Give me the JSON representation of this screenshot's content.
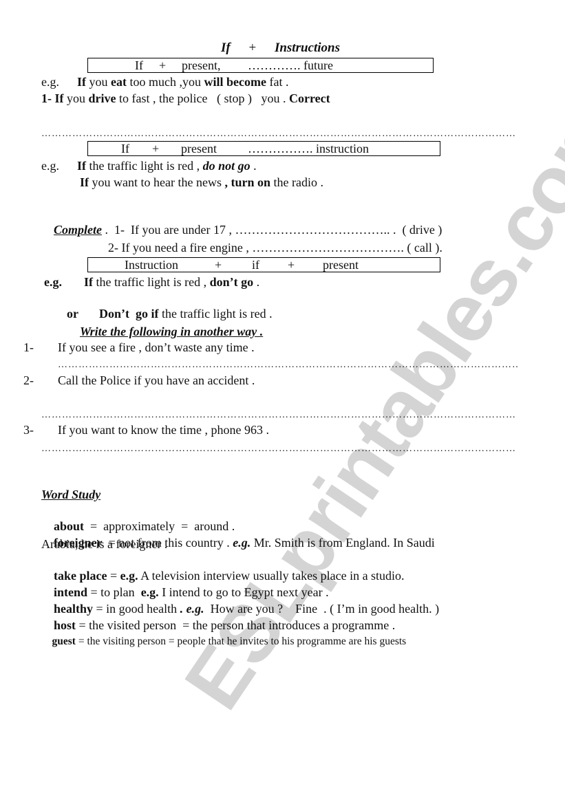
{
  "watermark": "ESLprintables.com",
  "title": {
    "if": "If",
    "plus": "+",
    "instructions": "Instructions"
  },
  "box1": {
    "if": "If",
    "plus": "+",
    "present": "present,",
    "dots": "…………. future"
  },
  "example1": {
    "eg": "e.g.",
    "if": "If",
    "you": " you ",
    "eat": "eat",
    "mid": " too much ,you ",
    "will_become": "will become",
    "end": " fat ."
  },
  "exercise1": {
    "num_if": "1- If",
    "you": " you ",
    "drive": "drive",
    "mid": " to fast , the police   ( stop )   you . ",
    "correct": "Correct"
  },
  "answer_line": "…………………………………………………………………………………………………………………………",
  "box2": {
    "if": "If",
    "plus": "+",
    "present": "present",
    "dots": "……………. instruction"
  },
  "example2": {
    "eg": "e.g.",
    "if": "If",
    "line1_rest": " the traffic light is red , ",
    "do_not_go": "do not go",
    "end1": " .",
    "if2": "If",
    "line2_mid": " you want to hear the news ",
    "turn_on": ", turn on",
    "line2_end": " the radio ."
  },
  "complete": {
    "label": "Complete",
    "item1": " .  1-  If you are under 17 , ……………………………….. .  ( drive )",
    "item2": "2- If you need a fire engine , ………………………………. (  call )."
  },
  "box3": {
    "instruction": "Instruction",
    "plus1": "+",
    "if": "if",
    "plus2": "+",
    "present": "present"
  },
  "example3": {
    "eg": "e.g.",
    "if": "If",
    "rest1": " the traffic light is red , ",
    "dont_go": "don’t go",
    "end1": " .",
    "or": "or",
    "dont_go_if": "Don’t  go if",
    "rest2": " the traffic light is red ."
  },
  "rewrite": {
    "heading": "Write the following in another way .",
    "items": [
      {
        "num": "1-",
        "text": "If you see a fire , don’t waste any time ."
      },
      {
        "num": "2-",
        "text": "Call the Police if you have an accident ."
      },
      {
        "num": "3-",
        "text": "If you want to know the time , phone 963 ."
      }
    ]
  },
  "word_study": {
    "heading": "Word Study",
    "entries": [
      {
        "word": "about",
        "def": "  =  approximately  =  around ."
      },
      {
        "word": "foreigner",
        "def": "  = not from this country . ",
        "eg": "e.g.",
        "ex": " Mr. Smith is from England. In Saudi",
        "ex2": "Arabia, he is a foreigner ."
      },
      {
        "word": "take place",
        "def": " = ",
        "eg": "e.g.",
        "ex": " A television interview usually takes place in a studio."
      },
      {
        "word": "intend",
        "def": " = to plan  ",
        "eg": "e.g.",
        "ex": " I intend to go to Egypt next year ."
      },
      {
        "word": "healthy",
        "def": " = in good health ",
        "eg": ". e.g.",
        "ex": "  How are you ?    Fine  . ( I’m in good health. )"
      },
      {
        "word": "host",
        "def": " = the visited person  = the person that introduces a programme ."
      },
      {
        "word": "guest",
        "def": " = the visiting person = people that he invites to his programme are his guests"
      }
    ]
  }
}
